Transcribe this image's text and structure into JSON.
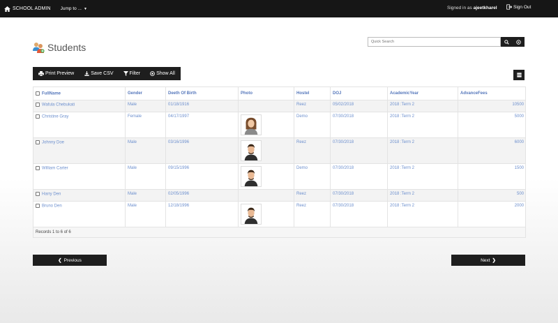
{
  "app": {
    "brand": "SCHOOL ADMIN",
    "jump_label": "Jump to ...",
    "signed_prefix": "Signed in as",
    "signed_user": "ajeetkharel",
    "signout_label": "Sign Out"
  },
  "page": {
    "title": "Students"
  },
  "search": {
    "placeholder": "Quick Search"
  },
  "toolbar": {
    "print_label": "Print Preview",
    "csv_label": "Save CSV",
    "filter_label": "Filter",
    "showall_label": "Show All"
  },
  "table": {
    "headers": [
      "FullName",
      "Gender",
      "Deeth Of Birth",
      "Photo",
      "Hostel",
      "DOJ",
      "AcademicYear",
      "AdvanceFees"
    ],
    "rows": [
      {
        "name": "Wafula Chebukati",
        "gender": "Male",
        "dob": "01/18/1916",
        "photo": "none",
        "hostel": "Reez",
        "doj": "05/02/2018",
        "year": "2018 :Term 2",
        "fees": "10500"
      },
      {
        "name": "Christine Gray",
        "gender": "Female",
        "dob": "04/17/1997",
        "photo": "female",
        "hostel": "Demo",
        "doj": "07/30/2018",
        "year": "2018 :Term 2",
        "fees": "5000"
      },
      {
        "name": "Johnny Doe",
        "gender": "Male",
        "dob": "03/16/1996",
        "photo": "male",
        "hostel": "Reez",
        "doj": "07/30/2018",
        "year": "2018 :Term 2",
        "fees": "6000"
      },
      {
        "name": "William Carter",
        "gender": "Male",
        "dob": "09/15/1996",
        "photo": "male",
        "hostel": "Demo",
        "doj": "07/30/2018",
        "year": "2018 :Term 2",
        "fees": "1500"
      },
      {
        "name": "Harry Den",
        "gender": "Male",
        "dob": "02/05/1996",
        "photo": "none",
        "hostel": "Reez",
        "doj": "07/30/2018",
        "year": "2018 :Term 2",
        "fees": "500"
      },
      {
        "name": "Bruno Den",
        "gender": "Male",
        "dob": "12/18/1996",
        "photo": "male",
        "hostel": "Reez",
        "doj": "07/30/2018",
        "year": "2018 :Term 2",
        "fees": "2000"
      }
    ],
    "footer": "Records 1 to 6 of 6"
  },
  "pager": {
    "prev_label": "Previous",
    "next_label": "Next"
  }
}
